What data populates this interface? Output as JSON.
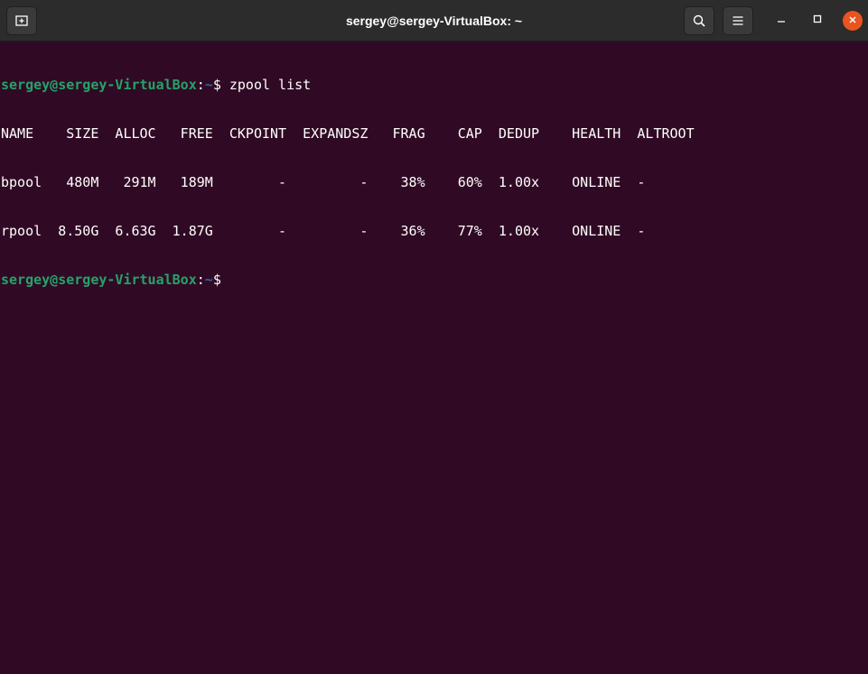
{
  "window": {
    "title": "sergey@sergey-VirtualBox: ~"
  },
  "icons": {
    "new_tab": "new-tab-icon",
    "search": "search-icon",
    "menu": "hamburger-menu-icon",
    "minimize": "minimize-icon",
    "maximize": "maximize-icon",
    "close": "close-icon"
  },
  "colors": {
    "terminal_bg": "#300a24",
    "prompt_user": "#26a269",
    "prompt_path": "#3465a4",
    "close_button": "#e95420"
  },
  "terminal": {
    "prompt": {
      "user_host": "sergey@sergey-VirtualBox",
      "separator": ":",
      "path": "~",
      "symbol": "$"
    },
    "command": " zpool list",
    "output": {
      "header": "NAME    SIZE  ALLOC   FREE  CKPOINT  EXPANDSZ   FRAG    CAP  DEDUP    HEALTH  ALTROOT",
      "rows": [
        "bpool   480M   291M   189M        -         -    38%    60%  1.00x    ONLINE  -",
        "rpool  8.50G  6.63G  1.87G        -         -    36%    77%  1.00x    ONLINE  -"
      ]
    }
  }
}
